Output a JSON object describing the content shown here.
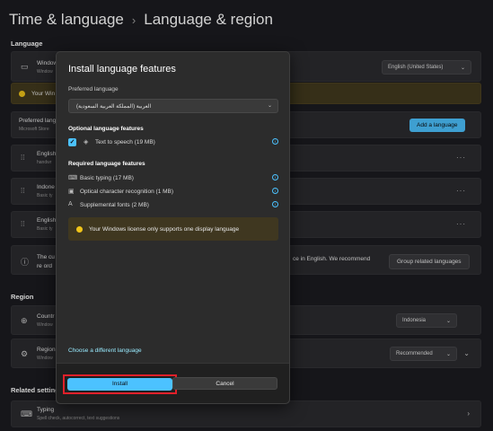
{
  "header": {
    "parent": "Time & language",
    "separator": "›",
    "current": "Language & region"
  },
  "language_section": {
    "label": "Language",
    "display_row": {
      "title": "Window",
      "subtitle": "Window",
      "dropdown_value": "English (United States)"
    },
    "warning_text": "Your Win",
    "preferred": {
      "title": "Preferred langua",
      "subtitle": "Microsoft Store",
      "add_button": "Add a language"
    },
    "languages": [
      {
        "title": "English",
        "subtitle": "handwr"
      },
      {
        "title": "Indone",
        "subtitle": "Basic ty"
      },
      {
        "title": "English",
        "subtitle": "Basic ty"
      }
    ],
    "info_row": {
      "line1_left": "The cu",
      "line2_left": "re ord",
      "line1_right": "ce in English. We recommend",
      "button": "Group related languages"
    }
  },
  "region_section": {
    "label": "Region",
    "country": {
      "title": "Countr",
      "subtitle": "Window",
      "value": "Indonesia"
    },
    "format": {
      "title": "Region",
      "subtitle": "Window",
      "value": "Recommended"
    }
  },
  "related_section": {
    "label": "Related settings",
    "typing": {
      "title": "Typing",
      "subtitle": "Spell check, autocorrect, text suggestions"
    }
  },
  "modal": {
    "title": "Install language features",
    "preferred_label": "Preferred language",
    "selected_language": "العربية (المملكة العربية السعودية)",
    "optional_heading": "Optional language features",
    "optional_features": [
      {
        "label": "Text to speech (19 MB)",
        "checked": true
      }
    ],
    "required_heading": "Required language features",
    "required_features": [
      {
        "label": "Basic typing (17 MB)",
        "icon": "keyboard-icon"
      },
      {
        "label": "Optical character recognition (1 MB)",
        "icon": "scan-icon"
      },
      {
        "label": "Supplemental fonts (2 MB)",
        "icon": "font-icon"
      }
    ],
    "warning": "Your Windows license only supports one display language",
    "choose_link": "Choose a different language",
    "install_button": "Install",
    "cancel_button": "Cancel"
  },
  "colors": {
    "accent": "#4cc2ff",
    "warning": "#f0c419",
    "highlight_outline": "#e0202a"
  }
}
